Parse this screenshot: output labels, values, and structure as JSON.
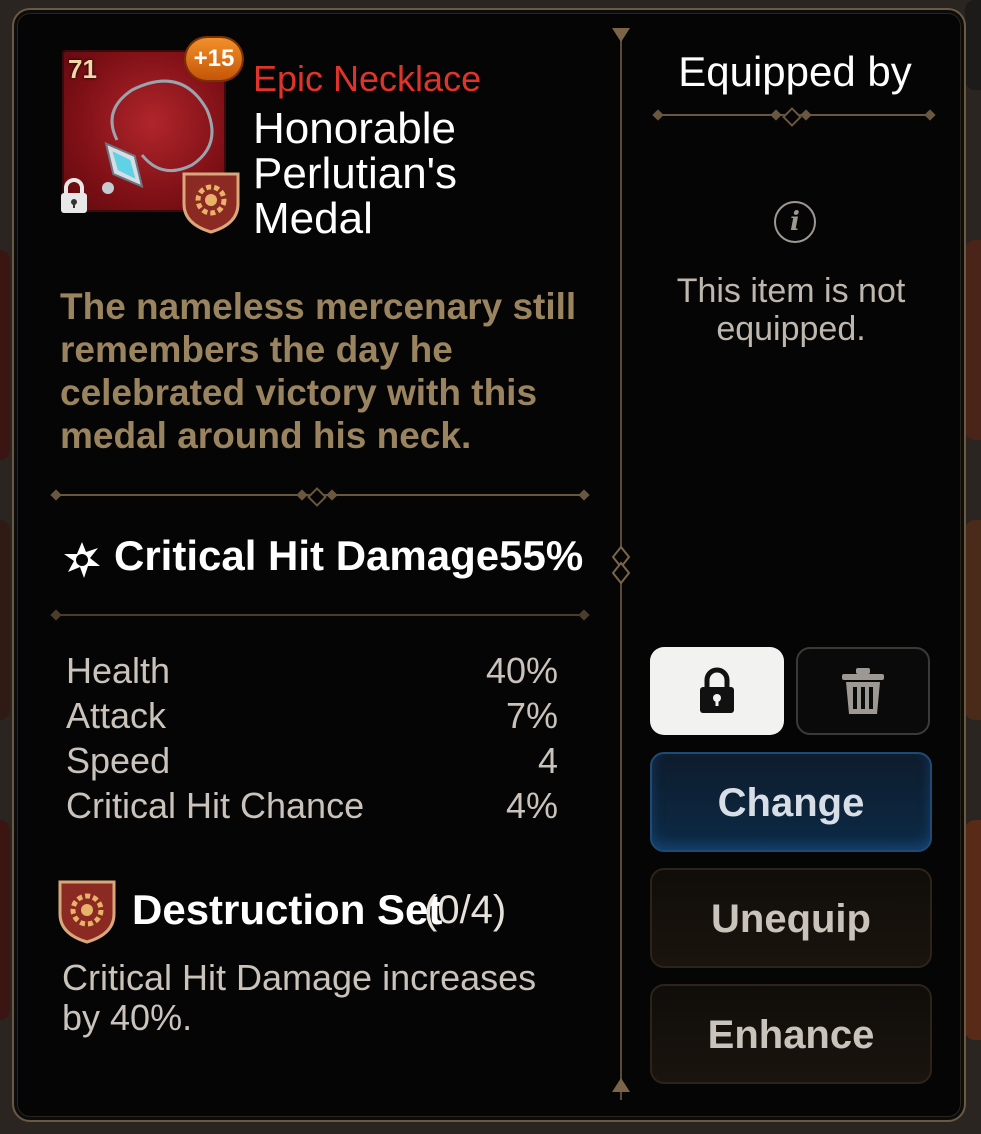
{
  "item": {
    "level": "71",
    "enhance_badge": "+15",
    "rarity": "Epic Necklace",
    "name": "Honorable Perlutian's Medal",
    "description": "The nameless mercenary still remembers the day he celebrated victory with this medal around his neck."
  },
  "main_stat": {
    "label": "Critical Hit Damage",
    "value": "55%"
  },
  "sub_stats": [
    {
      "label": "Health",
      "value": "40%"
    },
    {
      "label": "Attack",
      "value": "7%"
    },
    {
      "label": "Speed",
      "value": "4"
    },
    {
      "label": "Critical Hit Chance",
      "value": "4%"
    }
  ],
  "set": {
    "name": "Destruction Set",
    "count": "(0/4)",
    "description": "Critical Hit Damage increases by 40%."
  },
  "equipped": {
    "title": "Equipped by",
    "info_icon": "i",
    "message": "This item is not equipped."
  },
  "buttons": {
    "change": "Change",
    "unequip": "Unequip",
    "enhance": "Enhance"
  },
  "colors": {
    "rarity": "#e0332a",
    "description": "#9a835f",
    "change_button": "#0c2a46",
    "lock_button": "#f2f2f0"
  },
  "icons": [
    "necklace-item-icon",
    "lock-icon",
    "destruction-set-icon",
    "critical-damage-icon",
    "info-icon",
    "trash-icon"
  ]
}
